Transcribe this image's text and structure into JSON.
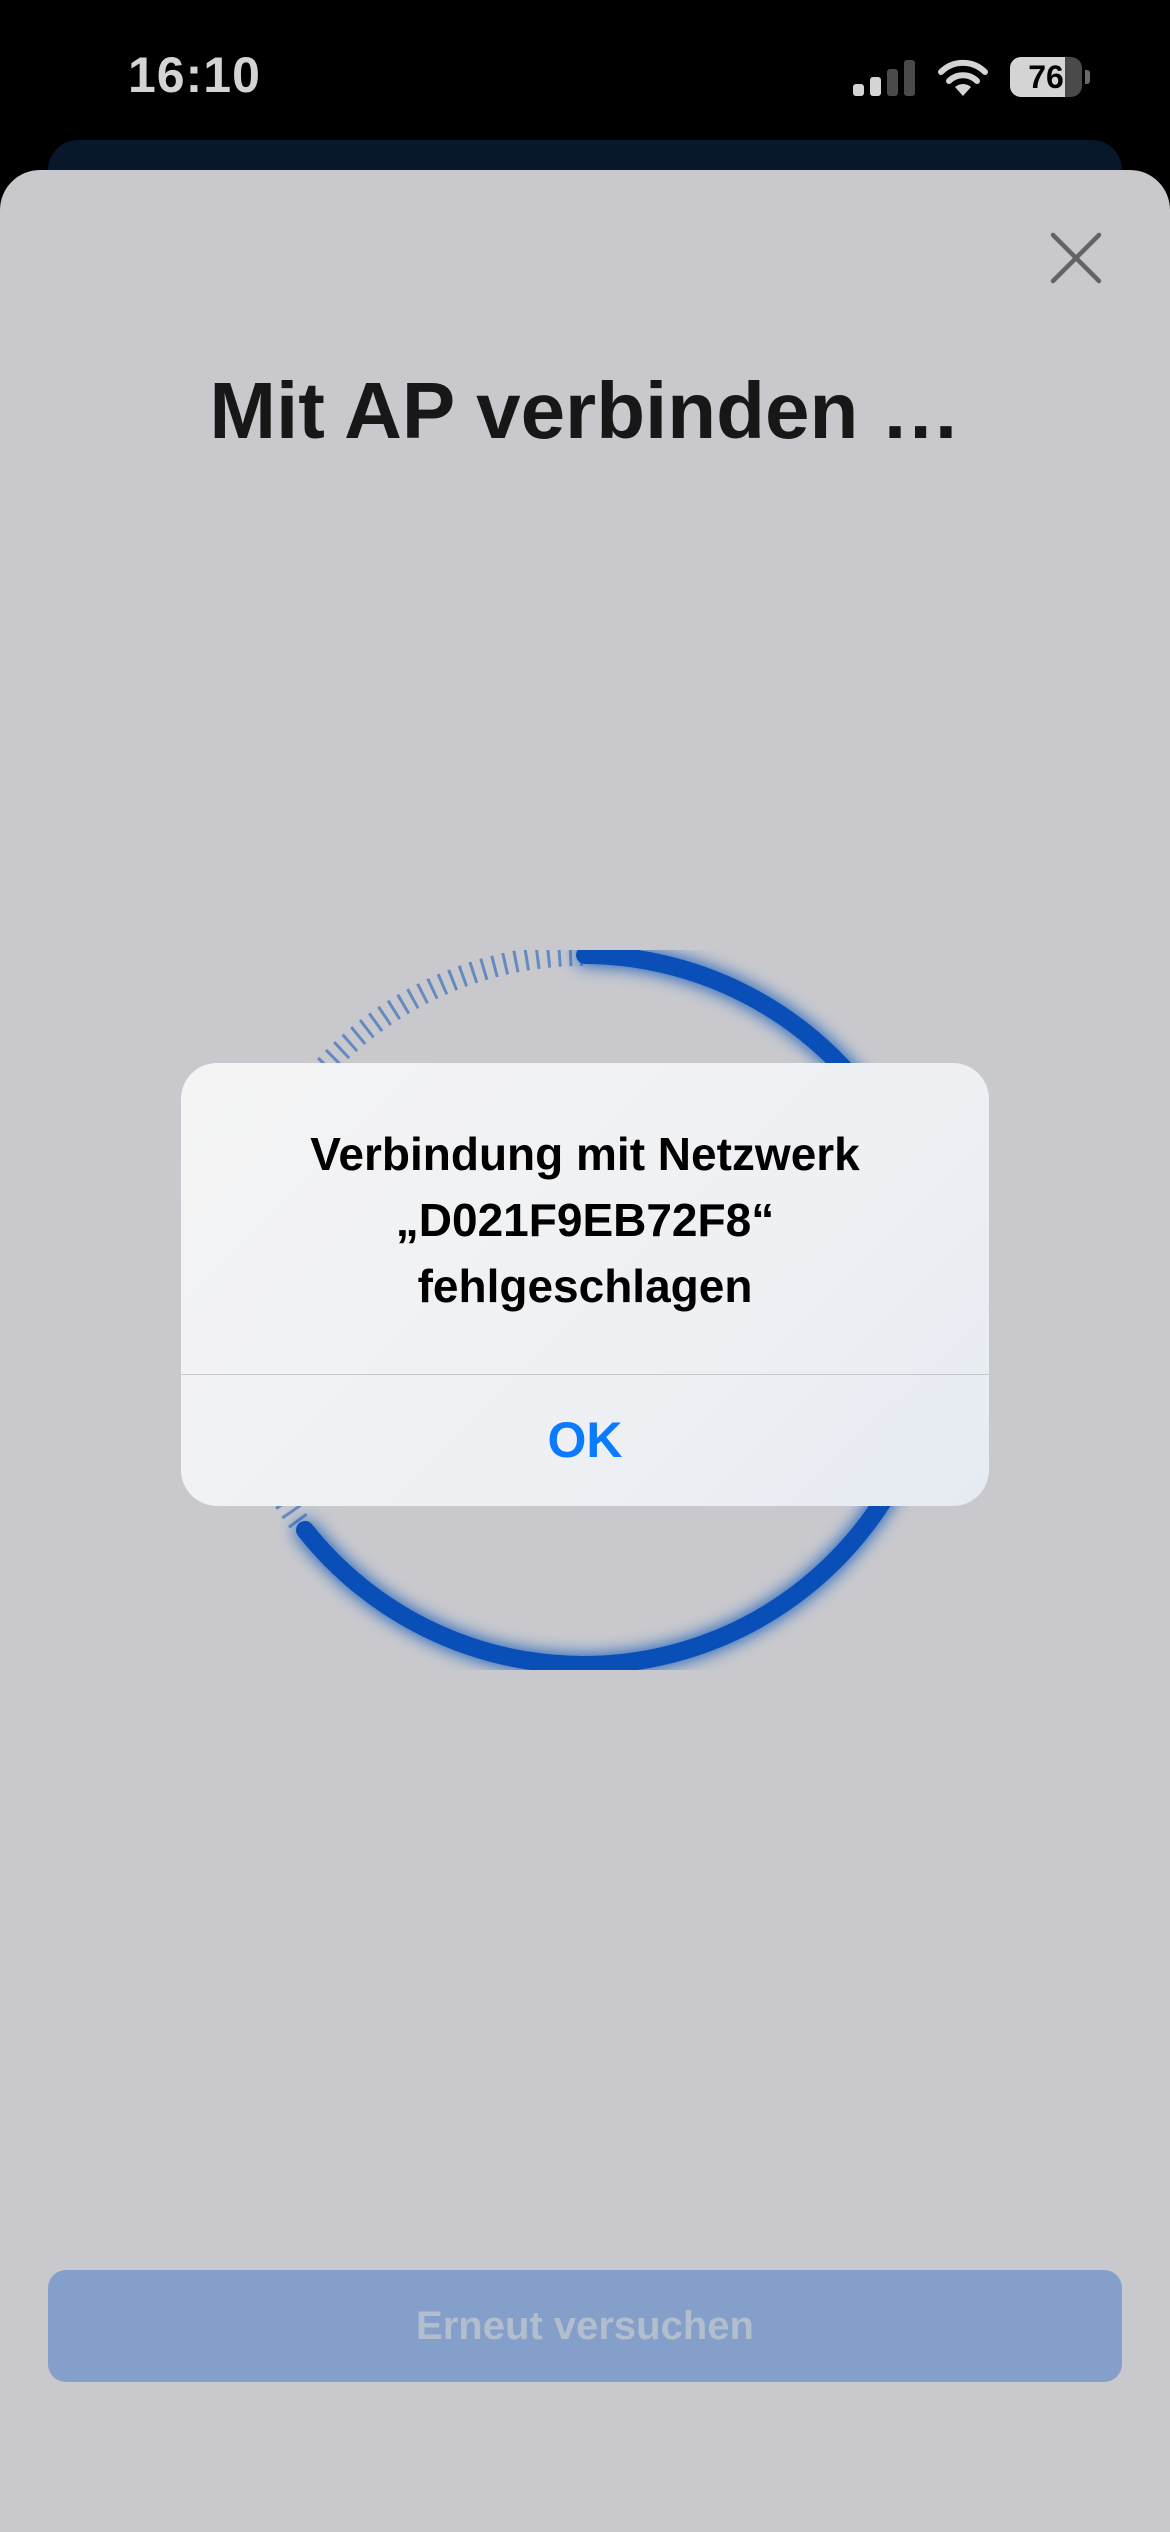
{
  "status_bar": {
    "time": "16:10",
    "battery": 76,
    "battery_label": "76",
    "signal_bars_active": 2,
    "icons": [
      "signal-icon",
      "wifi-icon",
      "battery-icon"
    ]
  },
  "sheet": {
    "title": "Mit AP verbinden …",
    "close_icon": "close-icon",
    "retry_label": "Erneut versuchen",
    "accent_color": "#0a5fde",
    "retry_color": "#9fc0f2"
  },
  "alert": {
    "line1": "Verbindung mit Netzwerk",
    "line2": "„D021F9EB72F8“",
    "line3": "fehlgeschlagen",
    "ok_label": "OK",
    "ok_color": "#0a7aff"
  }
}
